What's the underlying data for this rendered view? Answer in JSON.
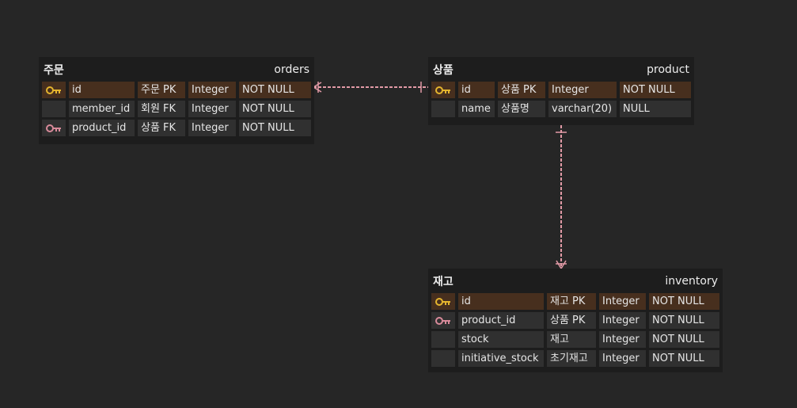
{
  "colors": {
    "pk_key": "#e5b52e",
    "fk_key": "#d88a9a",
    "relation": "#e29aa6",
    "pk_row": "#472f1e"
  },
  "entities": [
    {
      "id": "orders",
      "display_name": "주문",
      "table_name": "orders",
      "columns": [
        {
          "key": "pk-key-icon",
          "name": "id",
          "comment": "주문 PK",
          "type": "Integer",
          "nullable": "NOT NULL"
        },
        {
          "key": "",
          "name": "member_id",
          "comment": "회원 FK",
          "type": "Integer",
          "nullable": "NOT NULL"
        },
        {
          "key": "fk-key-icon",
          "name": "product_id",
          "comment": "상품 FK",
          "type": "Integer",
          "nullable": "NOT NULL"
        }
      ]
    },
    {
      "id": "product",
      "display_name": "상품",
      "table_name": "product",
      "columns": [
        {
          "key": "pk-key-icon",
          "name": "id",
          "comment": "상품 PK",
          "type": "Integer",
          "nullable": "NOT NULL"
        },
        {
          "key": "",
          "name": "name",
          "comment": "상품명",
          "type": "varchar(20)",
          "nullable": "NULL"
        }
      ]
    },
    {
      "id": "inventory",
      "display_name": "재고",
      "table_name": "inventory",
      "columns": [
        {
          "key": "pk-key-icon",
          "name": "id",
          "comment": "재고 PK",
          "type": "Integer",
          "nullable": "NOT NULL"
        },
        {
          "key": "fk-key-icon",
          "name": "product_id",
          "comment": "상품 PK",
          "type": "Integer",
          "nullable": "NOT NULL"
        },
        {
          "key": "",
          "name": "stock",
          "comment": "재고",
          "type": "Integer",
          "nullable": "NOT NULL"
        },
        {
          "key": "",
          "name": "initiative_stock",
          "comment": "초기재고",
          "type": "Integer",
          "nullable": "NOT NULL"
        }
      ]
    }
  ],
  "relations": [
    {
      "from": "product",
      "to": "orders",
      "from_end": "one",
      "to_end": "many"
    },
    {
      "from": "product",
      "to": "inventory",
      "from_end": "one",
      "to_end": "many"
    }
  ]
}
